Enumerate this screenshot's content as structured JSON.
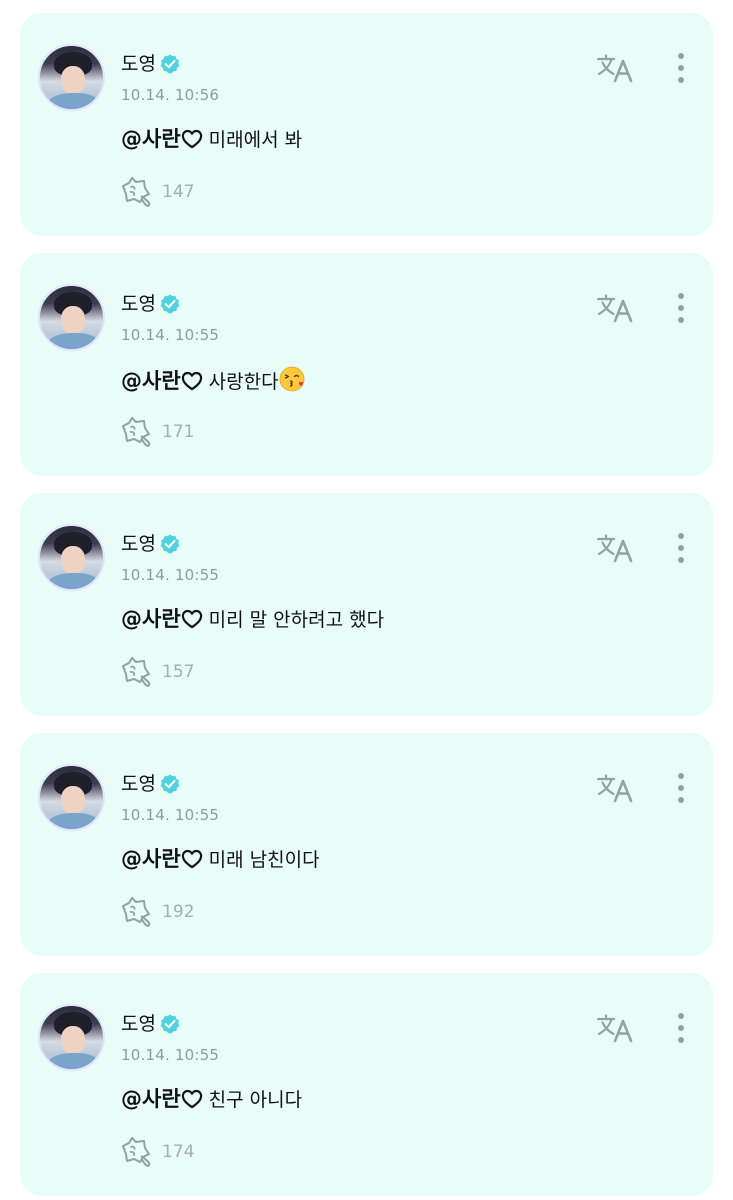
{
  "posts": [
    {
      "author": "도영",
      "time": "10.14. 10:56",
      "mention": "@사란",
      "text": "미래에서 봐",
      "emoji": "",
      "reactions": "147"
    },
    {
      "author": "도영",
      "time": "10.14. 10:55",
      "mention": "@사란",
      "text": "사랑한다",
      "emoji": "face-throwing-kiss",
      "reactions": "171"
    },
    {
      "author": "도영",
      "time": "10.14. 10:55",
      "mention": "@사란",
      "text": "미리 말 안하려고 했다",
      "emoji": "",
      "reactions": "157"
    },
    {
      "author": "도영",
      "time": "10.14. 10:55",
      "mention": "@사란",
      "text": "미래 남친이다",
      "emoji": "",
      "reactions": "192"
    },
    {
      "author": "도영",
      "time": "10.14. 10:55",
      "mention": "@사란",
      "text": "친구 아니다",
      "emoji": "",
      "reactions": "174"
    }
  ],
  "icons": {
    "verified": "verified-badge-icon",
    "translate": "translate-icon",
    "more": "more-vertical-icon",
    "reaction": "reaction-icon",
    "heart": "heart-outline-icon"
  },
  "colors": {
    "card_background": "#e8fdf8",
    "verified": "#4cd3de",
    "muted_text": "#8d9a9c",
    "icon": "#8fa3a4"
  }
}
